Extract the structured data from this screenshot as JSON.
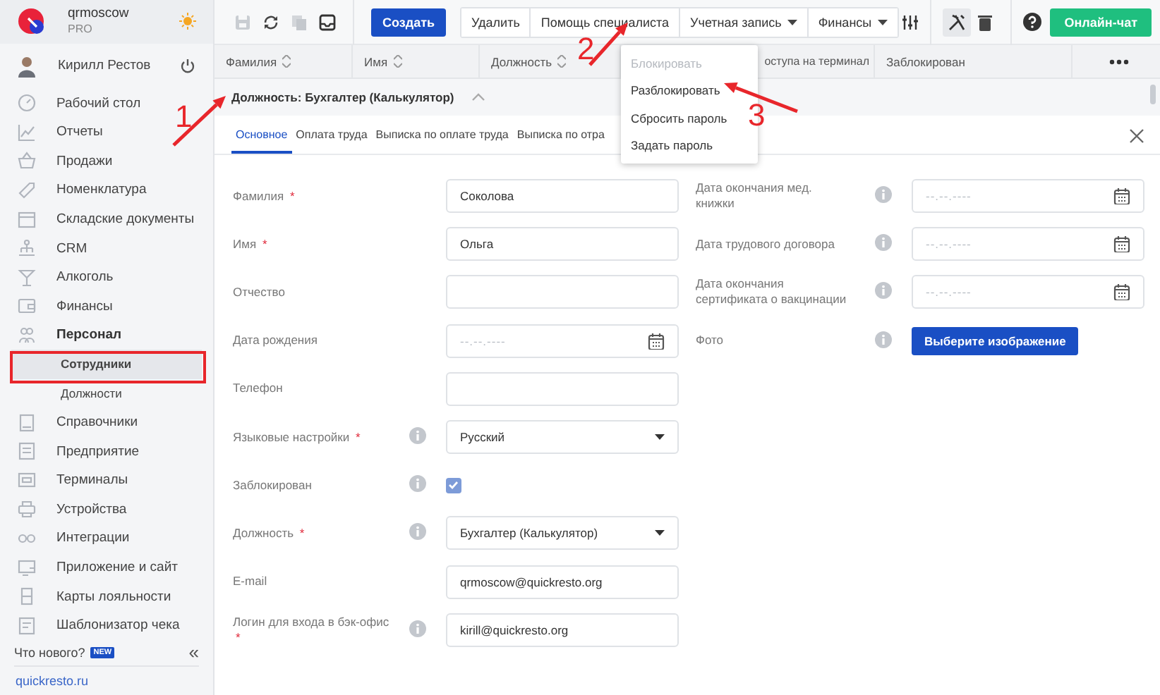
{
  "brand": {
    "name": "qrmoscow",
    "plan": "PRO"
  },
  "user": {
    "name": "Кирилл Рестов"
  },
  "sidebar": {
    "items": [
      {
        "label": "Рабочий стол",
        "selected": false
      },
      {
        "label": "Отчеты",
        "selected": false
      },
      {
        "label": "Продажи",
        "selected": false
      },
      {
        "label": "Номенклатура",
        "selected": false
      },
      {
        "label": "Складские документы",
        "selected": false
      },
      {
        "label": "CRM",
        "selected": false
      },
      {
        "label": "Алкоголь",
        "selected": false
      },
      {
        "label": "Финансы",
        "selected": false
      },
      {
        "label": "Персонал",
        "selected": false,
        "expanded": true,
        "children": [
          {
            "label": "Сотрудники",
            "selected": true
          },
          {
            "label": "Должности",
            "selected": false
          }
        ]
      },
      {
        "label": "Справочники",
        "selected": false
      },
      {
        "label": "Предприятие",
        "selected": false
      },
      {
        "label": "Терминалы",
        "selected": false
      },
      {
        "label": "Устройства",
        "selected": false
      },
      {
        "label": "Интеграции",
        "selected": false
      },
      {
        "label": "Приложение и сайт",
        "selected": false
      },
      {
        "label": "Карты лояльности",
        "selected": false
      },
      {
        "label": "Шаблонизатор чека",
        "selected": false
      }
    ],
    "whats_new": "Что нового?",
    "new_badge": "NEW",
    "collapse": "«",
    "site_link": "quickresto.ru"
  },
  "toolbar": {
    "create": "Создать",
    "actions": [
      {
        "label": "Удалить",
        "dropdown": false
      },
      {
        "label": "Помощь специалиста",
        "dropdown": false
      },
      {
        "label": "Учетная запись",
        "dropdown": true
      },
      {
        "label": "Финансы",
        "dropdown": true
      }
    ],
    "chat": "Онлайн-чат"
  },
  "table": {
    "columns": [
      {
        "label": "Фамилия",
        "sortable": true
      },
      {
        "label": "Имя",
        "sortable": true
      },
      {
        "label": "Должность",
        "sortable": true
      },
      {
        "label": "оступа на терминал",
        "sortable": false
      },
      {
        "label": "Заблокирован",
        "sortable": false
      }
    ]
  },
  "group": {
    "label": "Должность: Бухгалтер (Калькулятор)",
    "expanded": true
  },
  "tabs": [
    {
      "label": "Основное",
      "selected": true
    },
    {
      "label": "Оплата труда",
      "selected": false
    },
    {
      "label": "Выписка по оплате труда",
      "selected": false
    },
    {
      "label": "Выписка по отра",
      "selected": false
    }
  ],
  "form": {
    "left": [
      {
        "kind": "text",
        "label": "Фамилия",
        "required_mark": "*",
        "info": false,
        "value": "Соколова"
      },
      {
        "kind": "text",
        "label": "Имя",
        "required_mark": "*",
        "info": false,
        "value": "Ольга"
      },
      {
        "kind": "text",
        "label": "Отчество",
        "info": false
      },
      {
        "kind": "date",
        "label": "Дата рождения",
        "info": false,
        "placeholder": "--.--.----"
      },
      {
        "kind": "text",
        "label": "Телефон",
        "info": false
      },
      {
        "kind": "select",
        "label": "Языковые настройки",
        "required_mark": "*",
        "info": true,
        "value": "Русский"
      },
      {
        "kind": "checkbox",
        "label": "Заблокирован",
        "info": true,
        "checked": true
      },
      {
        "kind": "select",
        "label": "Должность",
        "required_mark": "*",
        "info": true,
        "value": "Бухгалтер (Калькулятор)"
      },
      {
        "kind": "text",
        "label": "E-mail",
        "info": false,
        "value": "qrmoscow@quickresto.org"
      },
      {
        "kind": "text",
        "label": "Логин для входа в бэк-офис",
        "required_mark": "*",
        "info": true,
        "value": "kirill@quickresto.org"
      }
    ],
    "right": [
      {
        "kind": "date",
        "label": "Дата окончания мед. книжки",
        "info": true,
        "placeholder": "--.--.----"
      },
      {
        "kind": "date",
        "label": "Дата трудового договора",
        "info": true,
        "placeholder": "--.--.----"
      },
      {
        "kind": "date",
        "label": "Дата окончания сертификата о вакцинации",
        "info": true,
        "placeholder": "--.--.----"
      },
      {
        "kind": "button",
        "label": "Фото",
        "info": true,
        "button": "Выберите изображение"
      }
    ]
  },
  "menu": {
    "items": [
      {
        "label": "Блокировать",
        "disabled": true
      },
      {
        "label": "Разблокировать",
        "disabled": false
      },
      {
        "label": "Сбросить пароль",
        "disabled": false
      },
      {
        "label": "Задать пароль",
        "disabled": false
      }
    ]
  },
  "annotations": [
    {
      "label": "1"
    },
    {
      "label": "2"
    },
    {
      "label": "3"
    }
  ]
}
